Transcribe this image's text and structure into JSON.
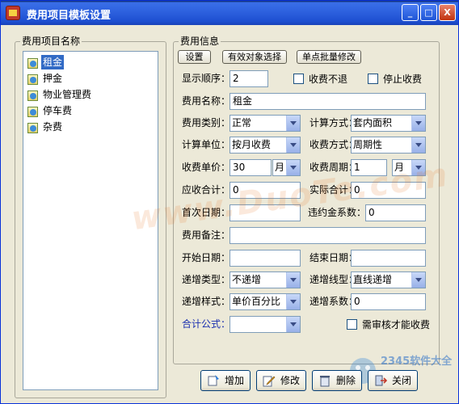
{
  "window": {
    "title": "费用项目模板设置",
    "min": "_",
    "max": "□",
    "close": "X"
  },
  "left_panel": {
    "legend": "费用项目名称",
    "items": [
      "租金",
      "押金",
      "物业管理费",
      "停车费",
      "杂费"
    ]
  },
  "right_panel": {
    "legend": "费用信息",
    "tabs": [
      "设置",
      "有效对象选择",
      "单点批量修改"
    ],
    "fields": {
      "display_order_label": "显示顺序：",
      "display_order_value": "2",
      "no_refund_label": "收费不退",
      "stop_charge_label": "停止收费",
      "fee_name_label": "费用名称：",
      "fee_name_value": "租金",
      "fee_type_label": "费用类别：",
      "fee_type_value": "正常",
      "calc_method_label": "计算方式：",
      "calc_method_value": "套内面积",
      "calc_unit_label": "计算单位：",
      "calc_unit_value": "按月收费",
      "charge_method_label": "收费方式：",
      "charge_method_value": "周期性",
      "unit_price_label": "收费单价：",
      "unit_price_value": "30",
      "unit_price_unit": "月",
      "charge_cycle_label": "收费周期：",
      "charge_cycle_value": "1",
      "charge_cycle_unit": "月",
      "receivable_label": "应收合计：",
      "receivable_value": "0",
      "actual_label": "实际合计：",
      "actual_value": "0",
      "first_date_label": "首次日期：",
      "first_date_value": "",
      "penalty_label": "违约金系数：",
      "penalty_value": "0",
      "note_label": "费用备注：",
      "note_value": "",
      "start_date_label": "开始日期：",
      "start_date_value": "",
      "end_date_label": "结束日期：",
      "end_date_value": "",
      "incr_type_label": "递增类型：",
      "incr_type_value": "不递增",
      "incr_line_label": "递增线型：",
      "incr_line_value": "直线递增",
      "incr_style_label": "递增样式：",
      "incr_style_value": "单价百分比",
      "incr_coef_label": "递增系数：",
      "incr_coef_value": "0",
      "formula_label": "合计公式：",
      "formula_value": "",
      "need_review_label": "需审核才能收费"
    }
  },
  "buttons": {
    "add": "增加",
    "edit": "修改",
    "delete": "删除",
    "close": "关闭"
  },
  "watermark": {
    "text": "www.DuoTe.com",
    "brand": "2345软件大全"
  },
  "colors": {
    "titlebar": "#2f63e0",
    "selection": "#316ac5",
    "window_bg": "#ece9d8",
    "blue_label": "#1a2fb0"
  }
}
